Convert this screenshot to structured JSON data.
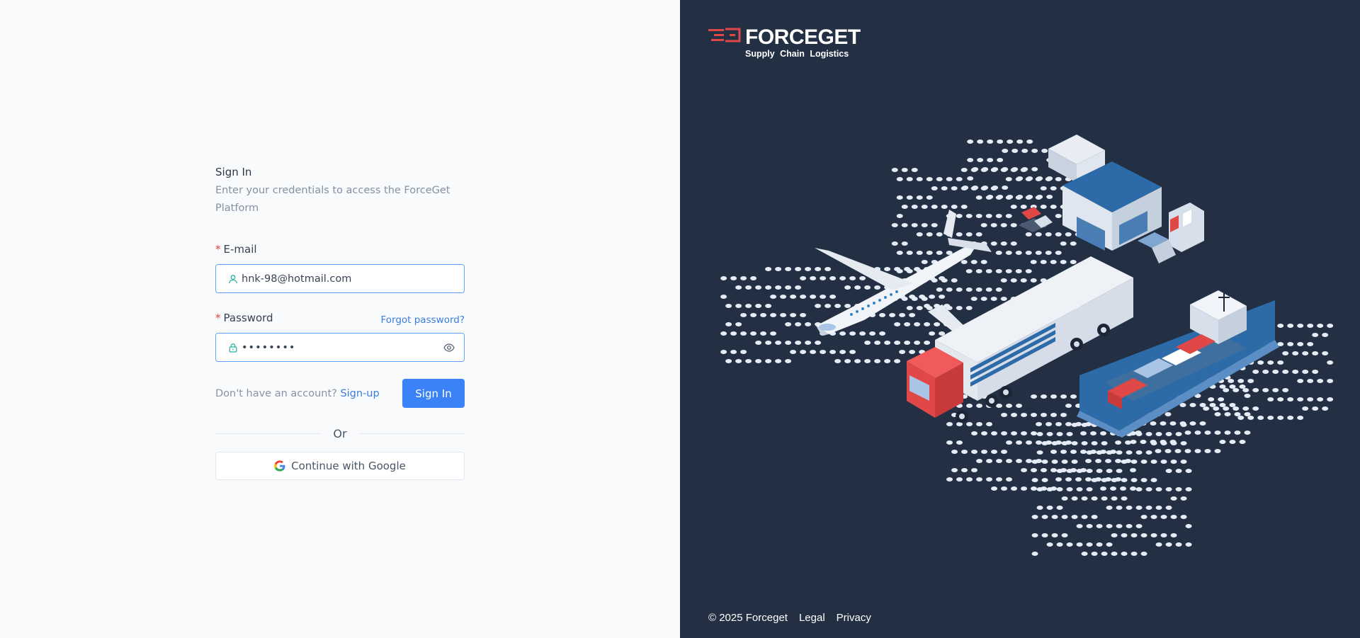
{
  "form": {
    "title": "Sign In",
    "subtitle": "Enter your credentials to access the ForceGet Platform",
    "email_label": "E-mail",
    "email_value": "hnk-98@hotmail.com",
    "password_label": "Password",
    "password_value": "••••••••",
    "forgot_link": "Forgot password?",
    "no_account_text": "Don't have an account?",
    "signup_link": "Sign-up",
    "signin_button": "Sign In",
    "divider_text": "Or",
    "google_button": "Continue with Google",
    "required_mark": "*"
  },
  "brand": {
    "name": "FORCEGET",
    "tagline": "Supply Chain Logistics",
    "icons": [
      "user-icon",
      "lock-icon",
      "eye-icon",
      "google-icon",
      "forceget-logo"
    ]
  },
  "footer": {
    "copyright": "© 2025 Forceget",
    "legal": "Legal",
    "privacy": "Privacy"
  },
  "colors": {
    "accent": "#3b82f6",
    "link": "#3b7ddd",
    "panel_dark": "#233044",
    "required": "#e53e3e",
    "logo_red": "#e04848",
    "icon_teal": "#2bb3a0"
  }
}
